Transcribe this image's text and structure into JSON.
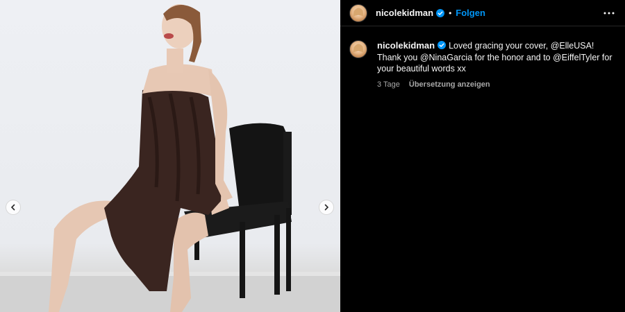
{
  "post": {
    "username": "nicolekidman",
    "follow_label": "Folgen",
    "separator": "•",
    "caption_text": "Loved gracing your cover, @ElleUSA! Thank you @NinaGarcia for the honor and to @EiffelTyler for your beautiful words xx",
    "timestamp": "3 Tage",
    "translate_label": "Übersetzung anzeigen"
  },
  "icons": {
    "verified": "verified-badge-icon",
    "more": "more-options-icon",
    "prev": "chevron-left-icon",
    "next": "chevron-right-icon"
  },
  "colors": {
    "accent": "#0095f6",
    "background": "#000000",
    "muted_text": "#a8a8a8"
  }
}
